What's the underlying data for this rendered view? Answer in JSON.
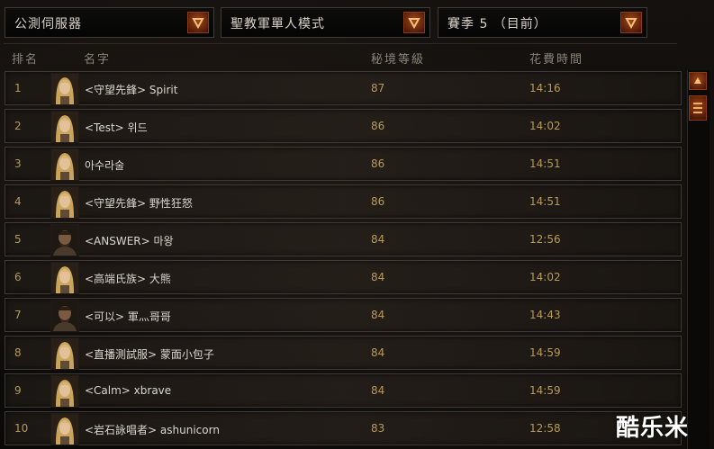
{
  "filters": {
    "server": "公測伺服器",
    "mode": "聖教軍單人模式",
    "season": "賽季 5 （目前）"
  },
  "columns": {
    "rank": "排名",
    "name": "名字",
    "rift_level": "秘境等級",
    "time": "花費時間"
  },
  "rows": [
    {
      "rank": "1",
      "name": "<守望先鋒> Spirit",
      "level": "87",
      "time": "14:16",
      "portrait": "female-crusader-portrait-icon"
    },
    {
      "rank": "2",
      "name": "<Test> 위드",
      "level": "86",
      "time": "14:02",
      "portrait": "female-crusader-portrait-icon"
    },
    {
      "rank": "3",
      "name": "아수라술",
      "level": "86",
      "time": "14:51",
      "portrait": "female-crusader-portrait-icon"
    },
    {
      "rank": "4",
      "name": "<守望先鋒> 野性狂怒",
      "level": "86",
      "time": "14:51",
      "portrait": "female-crusader-portrait-icon"
    },
    {
      "rank": "5",
      "name": "<ANSWER> 마왕",
      "level": "84",
      "time": "12:56",
      "portrait": "male-crusader-portrait-icon"
    },
    {
      "rank": "6",
      "name": "<高端氏族> 大熊",
      "level": "84",
      "time": "14:02",
      "portrait": "female-crusader-portrait-icon"
    },
    {
      "rank": "7",
      "name": "<可以> 軍灬哥哥",
      "level": "84",
      "time": "14:43",
      "portrait": "male-crusader-portrait-icon"
    },
    {
      "rank": "8",
      "name": "<直播測試服> 蒙面小包子",
      "level": "84",
      "time": "14:59",
      "portrait": "female-crusader-portrait-icon"
    },
    {
      "rank": "9",
      "name": "<Calm> xbrave",
      "level": "84",
      "time": "14:59",
      "portrait": "female-crusader-portrait-icon"
    },
    {
      "rank": "10",
      "name": "<岩石詠唱者> ashunicorn",
      "level": "83",
      "time": "12:58",
      "portrait": "female-crusader-portrait-icon"
    }
  ],
  "watermark": "酷乐米",
  "colors": {
    "accent": "#a4461a",
    "value_text": "#b99a55",
    "name_text": "#d9d6cf",
    "header_text": "#8d8478"
  }
}
